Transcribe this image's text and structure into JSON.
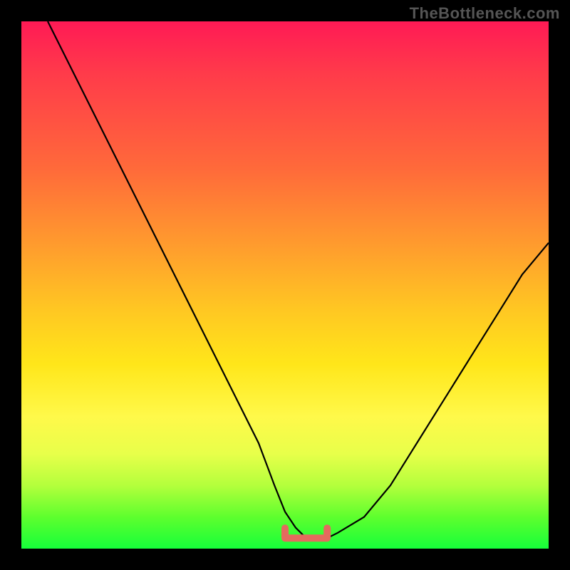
{
  "watermark": "TheBottleneck.com",
  "chart_data": {
    "type": "line",
    "title": "",
    "xlabel": "",
    "ylabel": "",
    "xlim": [
      0,
      100
    ],
    "ylim": [
      0,
      100
    ],
    "series": [
      {
        "name": "bottleneck-curve",
        "x": [
          5,
          10,
          15,
          20,
          25,
          30,
          35,
          40,
          45,
          48,
          50,
          52,
          54,
          56,
          58,
          60,
          65,
          70,
          75,
          80,
          85,
          90,
          95,
          100
        ],
        "values": [
          100,
          90,
          80,
          70,
          60,
          50,
          40,
          30,
          20,
          12,
          7,
          4,
          2,
          2,
          2,
          3,
          6,
          12,
          20,
          28,
          36,
          44,
          52,
          58
        ]
      }
    ],
    "annotations": [
      {
        "name": "valley-marker",
        "x_range": [
          50,
          58
        ],
        "y": 2
      }
    ],
    "background_gradient": {
      "direction": "vertical",
      "stops": [
        {
          "pos": 0,
          "color": "#ff1a55"
        },
        {
          "pos": 28,
          "color": "#ff6a3a"
        },
        {
          "pos": 55,
          "color": "#ffc822"
        },
        {
          "pos": 75,
          "color": "#fff94a"
        },
        {
          "pos": 94,
          "color": "#5eff2e"
        },
        {
          "pos": 100,
          "color": "#16ff3a"
        }
      ]
    }
  }
}
